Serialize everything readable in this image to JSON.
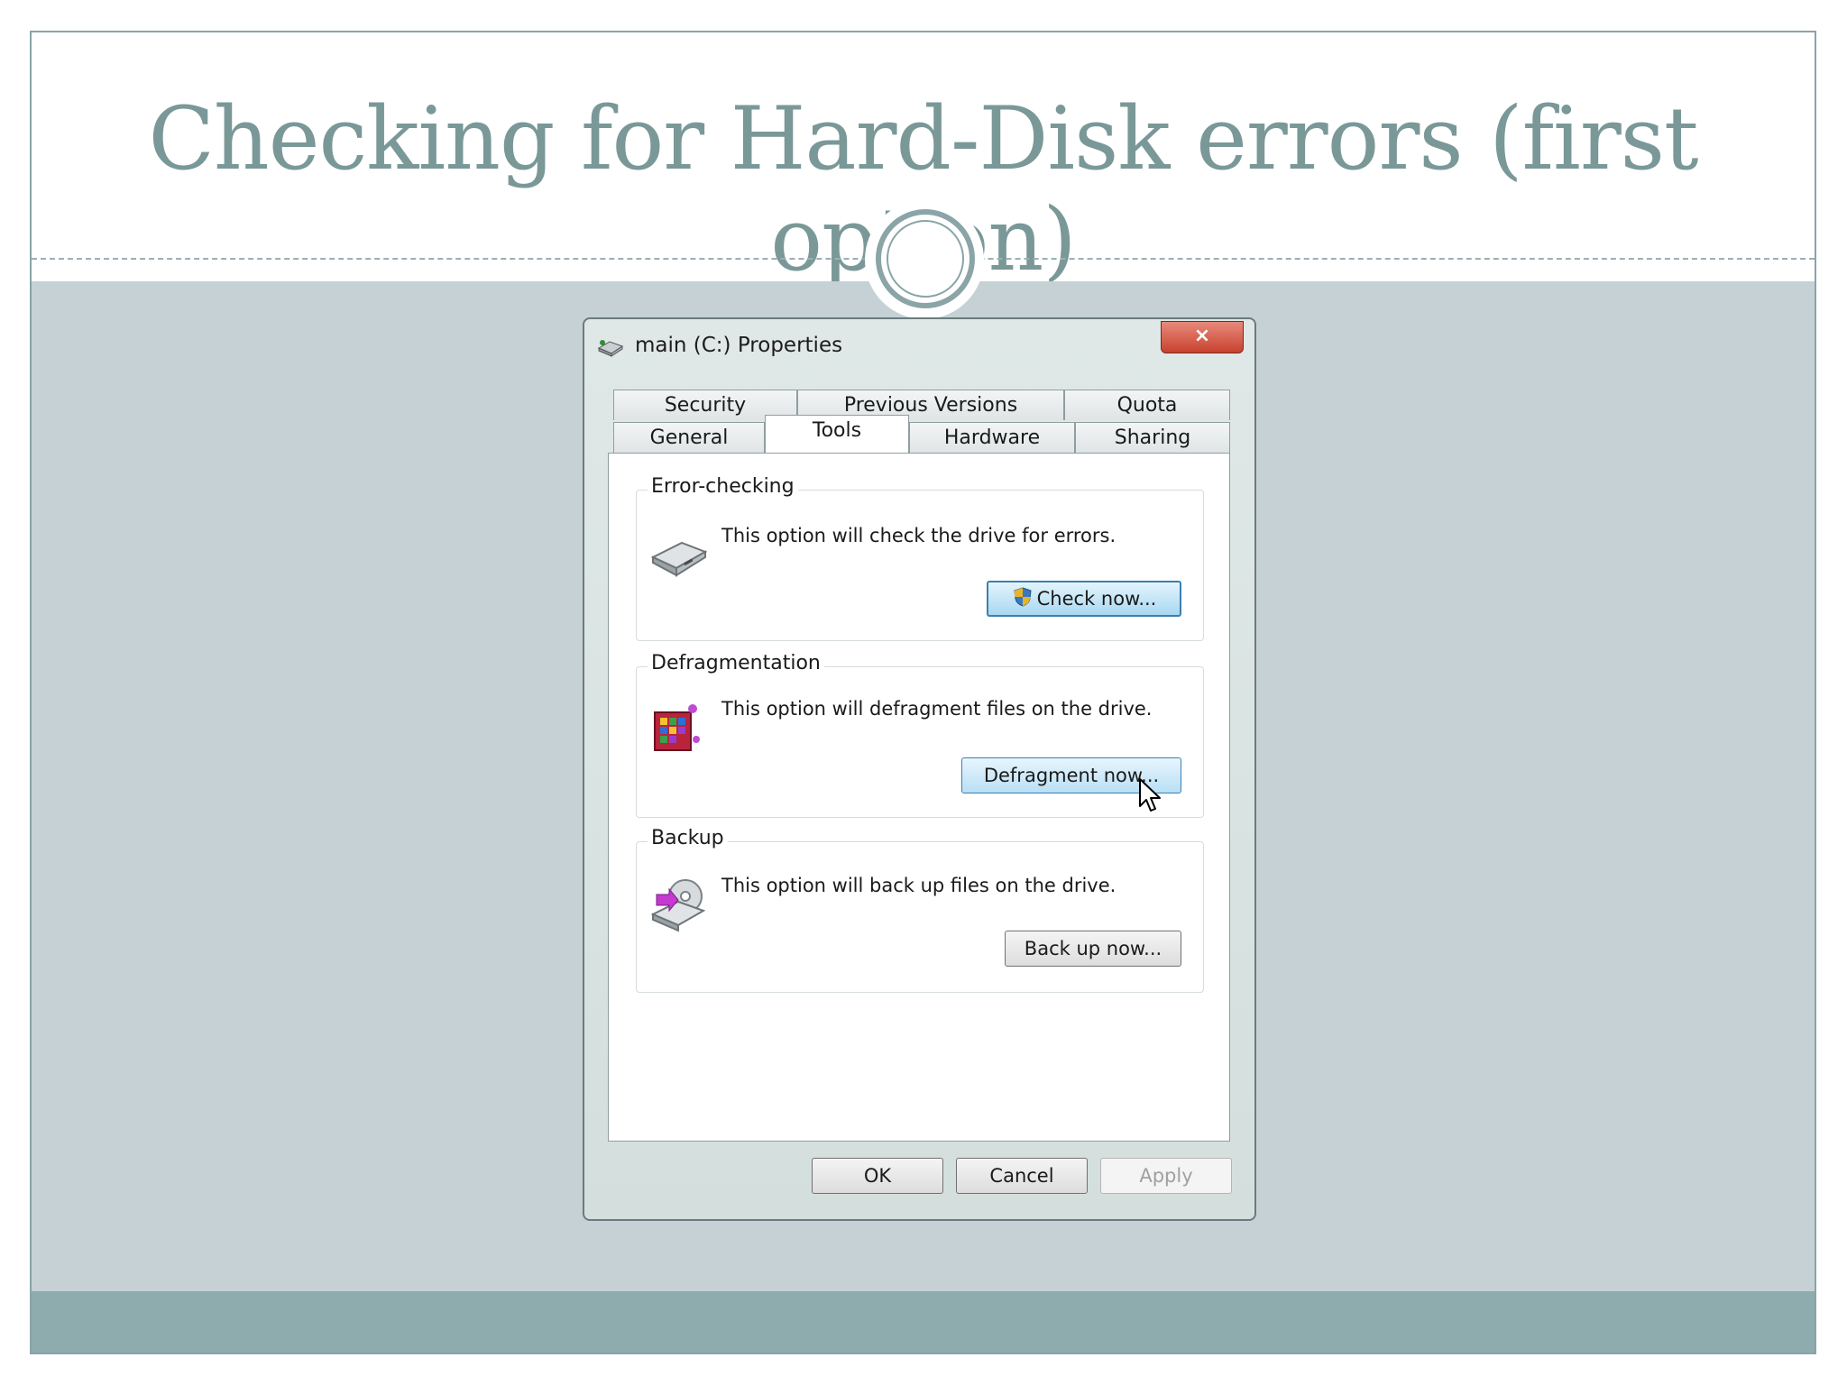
{
  "slide": {
    "title": "Checking for Hard-Disk errors (first option)"
  },
  "dialog": {
    "title": "main (C:) Properties",
    "close_label": "×",
    "tabs_back": [
      "Security",
      "Previous Versions",
      "Quota"
    ],
    "tabs_front": [
      "General",
      "Tools",
      "Hardware",
      "Sharing"
    ],
    "active_tab": "Tools",
    "groups": {
      "error_checking": {
        "label": "Error-checking",
        "description": "This option will check the drive for errors.",
        "button": "Check now..."
      },
      "defragmentation": {
        "label": "Defragmentation",
        "description": "This option will defragment files on the drive.",
        "button": "Defragment now..."
      },
      "backup": {
        "label": "Backup",
        "description": "This option will back up files on the drive.",
        "button": "Back up now..."
      }
    },
    "footer": {
      "ok": "OK",
      "cancel": "Cancel",
      "apply": "Apply"
    }
  },
  "icons": {
    "drive": "drive-icon",
    "defrag": "defrag-icon",
    "backup": "backup-icon",
    "shield": "uac-shield-icon",
    "cursor": "mouse-pointer-icon"
  },
  "colors": {
    "title": "#7a9898",
    "content_background": "#c5d1d4",
    "footer_band": "#8eabad",
    "close_button": "#c8412e",
    "focus_button_border": "#3c7fb1"
  }
}
